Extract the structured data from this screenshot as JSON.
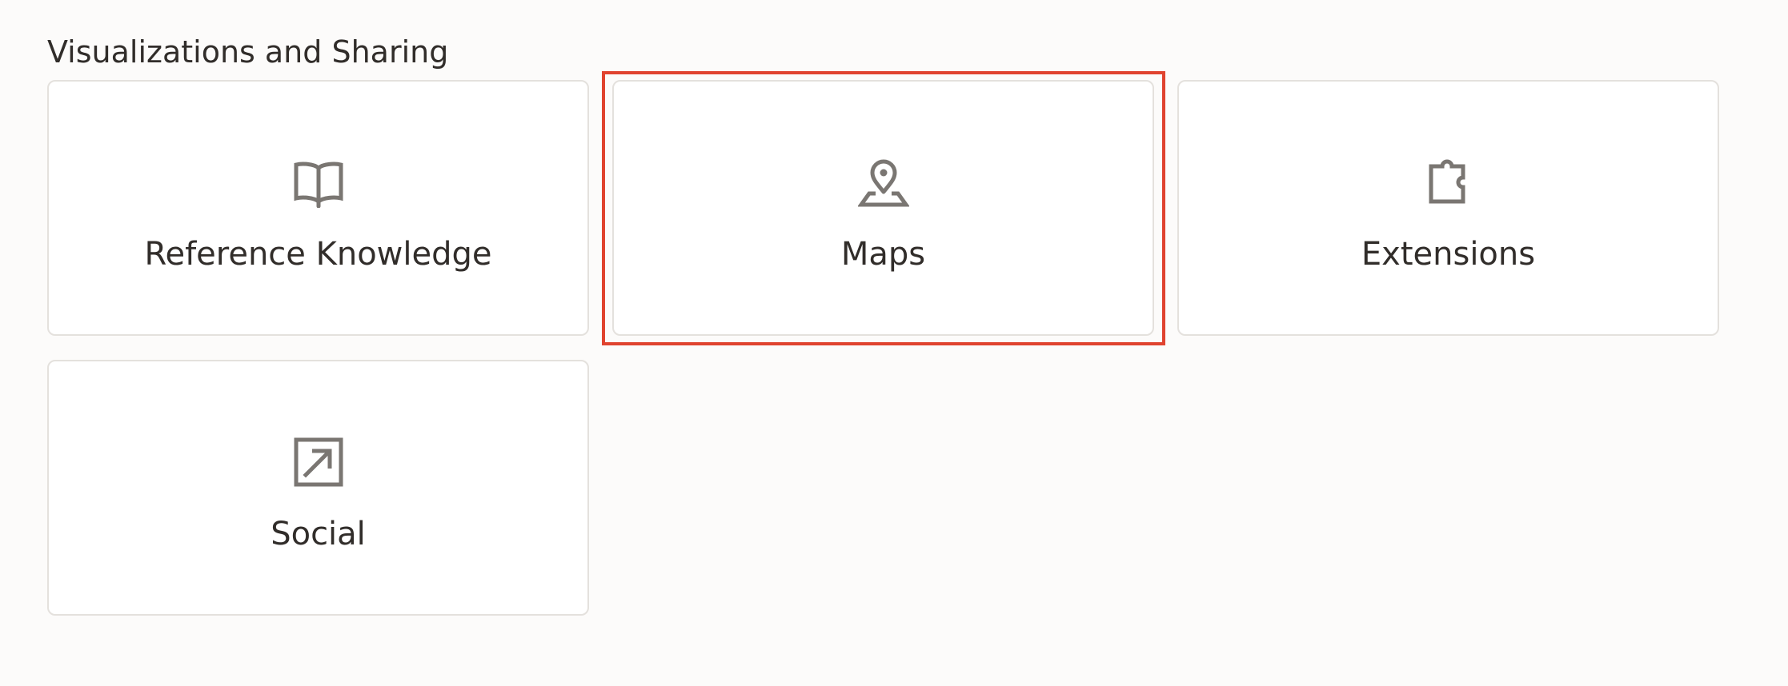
{
  "section": {
    "title": "Visualizations and Sharing"
  },
  "tiles": [
    {
      "label": "Reference Knowledge",
      "icon": "book-icon"
    },
    {
      "label": "Maps",
      "icon": "map-pin-icon"
    },
    {
      "label": "Extensions",
      "icon": "puzzle-piece-icon"
    },
    {
      "label": "Social",
      "icon": "share-external-icon"
    }
  ],
  "highlight": {
    "target": "Maps",
    "color": "#e0432f"
  },
  "colors": {
    "icon": "#7a7672",
    "text": "#312d2a",
    "tile_border": "#e4e1dd",
    "background": "#fcfbfa"
  }
}
